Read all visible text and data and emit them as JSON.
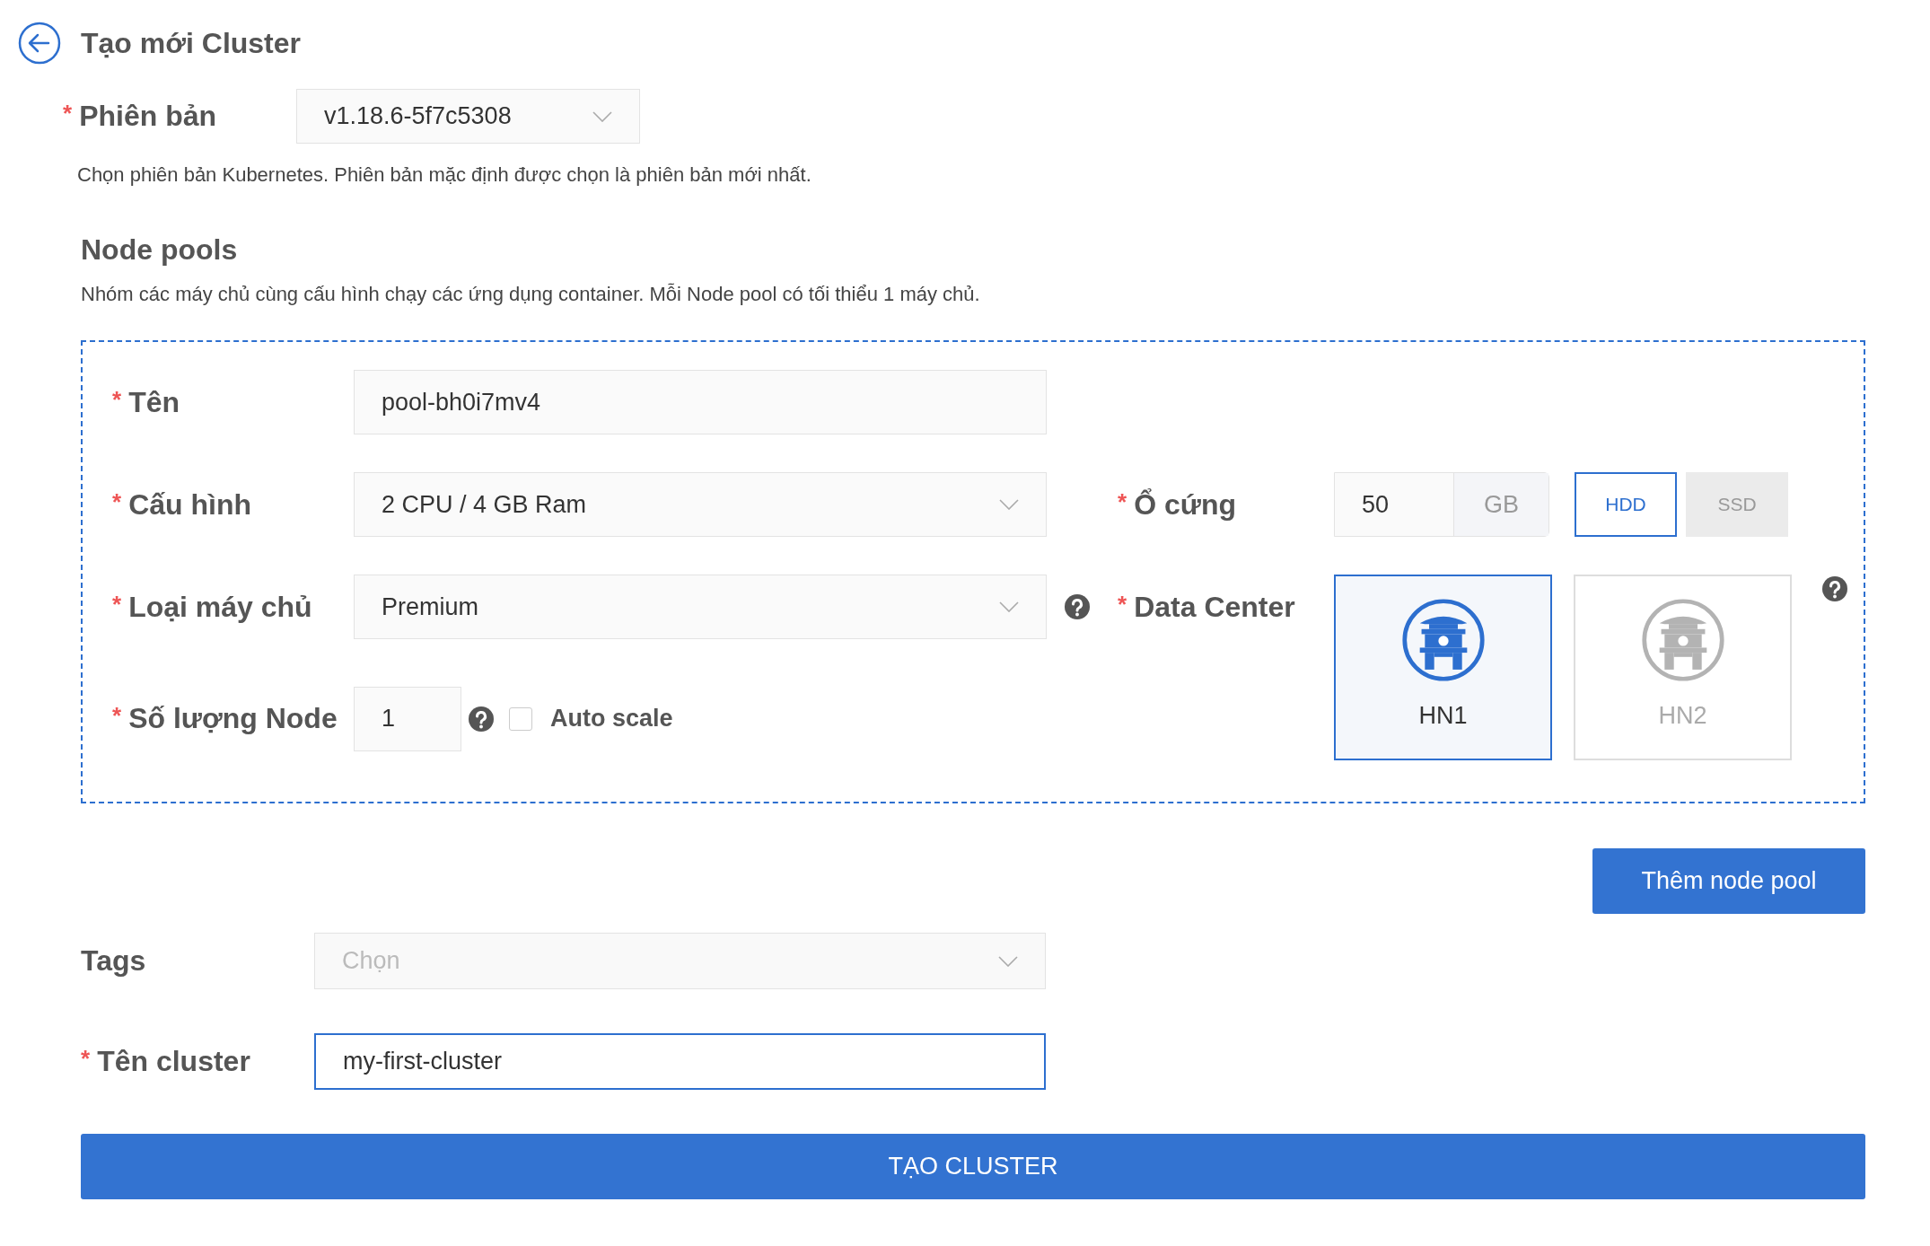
{
  "header": {
    "title": "Tạo mới Cluster"
  },
  "version": {
    "label": "Phiên bản",
    "required_mark": "*",
    "value": "v1.18.6-5f7c5308",
    "help": "Chọn phiên bản Kubernetes. Phiên bản mặc định được chọn là phiên bản mới nhất."
  },
  "node_pools": {
    "title": "Node pools",
    "description": "Nhóm các máy chủ cùng cấu hình chạy các ứng dụng container. Mỗi Node pool có tối thiểu 1 máy chủ.",
    "pool": {
      "name": {
        "label": "Tên",
        "required_mark": "*",
        "value": "pool-bh0i7mv4"
      },
      "config": {
        "label": "Cấu hình",
        "required_mark": "*",
        "value": "2 CPU / 4 GB Ram"
      },
      "server_type": {
        "label": "Loại máy chủ",
        "required_mark": "*",
        "value": "Premium"
      },
      "node_count": {
        "label": "Số lượng Node",
        "required_mark": "*",
        "value": "1",
        "auto_scale": {
          "label": "Auto scale",
          "checked": false
        }
      },
      "disk": {
        "label": "Ổ cứng",
        "required_mark": "*",
        "value": "50",
        "unit": "GB",
        "types": [
          {
            "label": "HDD",
            "selected": true
          },
          {
            "label": "SSD",
            "selected": false
          }
        ]
      },
      "data_center": {
        "label": "Data Center",
        "required_mark": "*",
        "options": [
          {
            "label": "HN1",
            "selected": true
          },
          {
            "label": "HN2",
            "selected": false
          }
        ]
      }
    },
    "add_button": "Thêm node pool"
  },
  "tags": {
    "label": "Tags",
    "placeholder": "Chọn"
  },
  "cluster_name": {
    "label": "Tên cluster",
    "required_mark": "*",
    "value": "my-first-cluster",
    "focused": true
  },
  "submit": "TẠO CLUSTER"
}
